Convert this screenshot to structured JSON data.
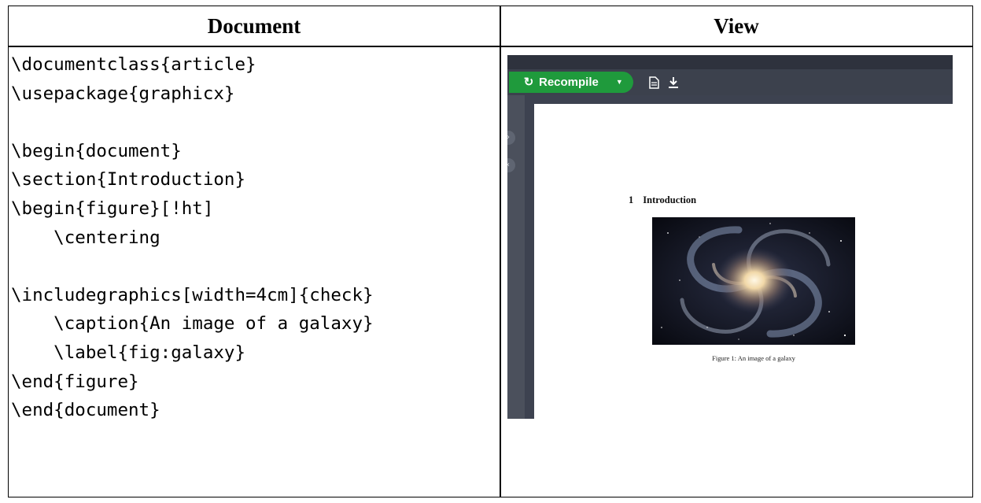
{
  "headers": {
    "document": "Document",
    "view": "View"
  },
  "code_lines": [
    "\\documentclass{article}",
    "\\usepackage{graphicx}",
    "",
    "\\begin{document}",
    "\\section{Introduction}",
    "\\begin{figure}[!ht]",
    "    \\centering",
    "",
    "\\includegraphics[width=4cm]{check}",
    "    \\caption{An image of a galaxy}",
    "    \\label{fig:galaxy}",
    "\\end{figure}",
    "\\end{document}"
  ],
  "viewer": {
    "recompile_label": "Recompile",
    "icons": [
      "refresh-icon",
      "caret-down-icon",
      "document-icon",
      "download-icon"
    ],
    "pdf": {
      "section_number": "1",
      "section_title": "Introduction",
      "caption": "Figure 1: An image of a galaxy"
    },
    "colors": {
      "recompile_green": "#1f9a3c",
      "toolbar": "#3c414d"
    }
  }
}
